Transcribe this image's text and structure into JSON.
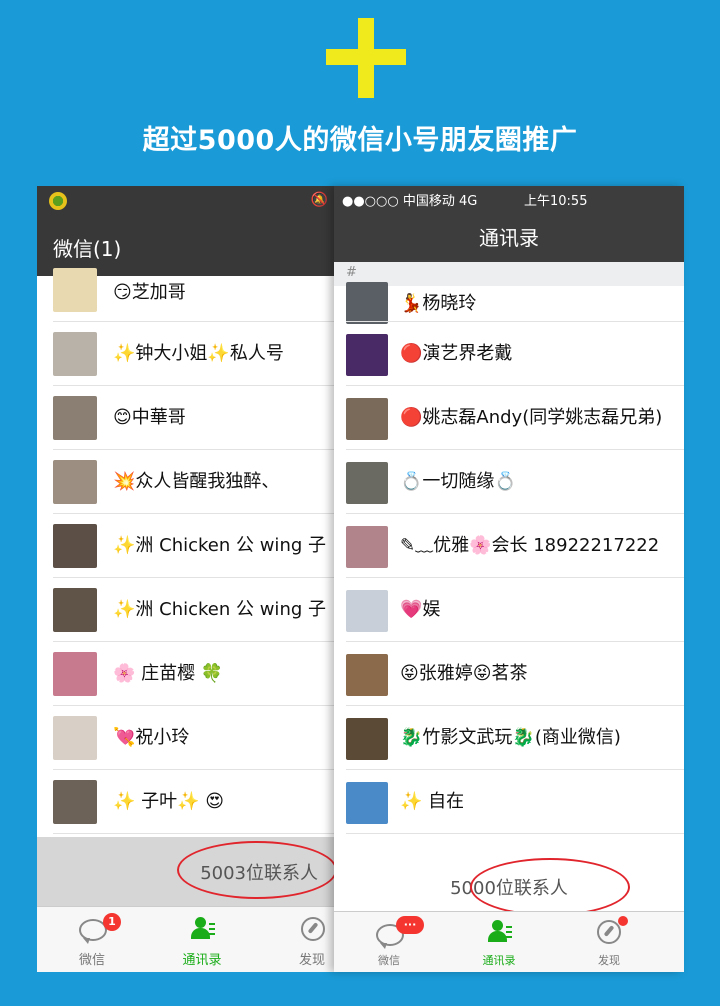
{
  "headline": "超过5000人的微信小号朋友圈推广",
  "colors": {
    "background": "#1a9bd7",
    "plus": "#f0ea1c",
    "wechat_green": "#1aad19",
    "highlight_oval": "#e1252d"
  },
  "left_phone": {
    "title": "微信(1)",
    "contacts": [
      {
        "name": "😏芝加哥",
        "avatar": "#e8d9b0"
      },
      {
        "name": "✨钟大小姐✨私人号",
        "avatar": "#b8b2a8"
      },
      {
        "name": "😊中華哥",
        "avatar": "#8a7f72"
      },
      {
        "name": "💥众人皆醒我独醉、",
        "avatar": "#9c8e80"
      },
      {
        "name": "✨洲 Chicken 公  wing 子",
        "avatar": "#5c5046"
      },
      {
        "name": "✨洲 Chicken 公  wing 子",
        "avatar": "#605449"
      },
      {
        "name": "🌸 庄苗樱 🍀",
        "avatar": "#c77a8e"
      },
      {
        "name": "💘祝小玲",
        "avatar": "#d8cfc6"
      },
      {
        "name": "✨ 子叶✨ 😍",
        "avatar": "#6d6258"
      }
    ],
    "contact_count": "5003位联系人",
    "tabs": [
      {
        "label": "微信",
        "icon": "chat-bubble-icon",
        "badge": "1"
      },
      {
        "label": "通讯录",
        "icon": "contacts-icon",
        "active": true
      },
      {
        "label": "发现",
        "icon": "compass-icon"
      }
    ]
  },
  "right_phone": {
    "carrier": "●●○○○ 中国移动  4G",
    "time": "上午10:55",
    "title": "通讯录",
    "section_header": "#",
    "contacts": [
      {
        "name": "💃杨晓玲",
        "avatar": "#5a5f66"
      },
      {
        "name": "🔴演艺界老戴",
        "avatar": "#4a2a66"
      },
      {
        "name": "🔴姚志磊Andy(同学姚志磊兄弟)",
        "avatar": "#7a6a5a"
      },
      {
        "name": "💍一切随缘💍",
        "avatar": "#6a6a62"
      },
      {
        "name": "✎﹏优雅🌸会长 18922217222",
        "avatar": "#b0848a"
      },
      {
        "name": "💗娱",
        "avatar": "#c8cfd8"
      },
      {
        "name": "😝张雅婷😝茗茶",
        "avatar": "#8a6a4a"
      },
      {
        "name": "🐉竹影文武玩🐉(商业微信)",
        "avatar": "#5a4a36"
      },
      {
        "name": "✨ 自在",
        "avatar": "#4a8ac8"
      }
    ],
    "contact_count": "5000位联系人",
    "tabs": [
      {
        "label": "微信",
        "icon": "chat-bubble-icon",
        "badge": "···"
      },
      {
        "label": "通讯录",
        "icon": "contacts-icon",
        "active": true
      },
      {
        "label": "发现",
        "icon": "compass-icon",
        "dot": true
      }
    ]
  }
}
